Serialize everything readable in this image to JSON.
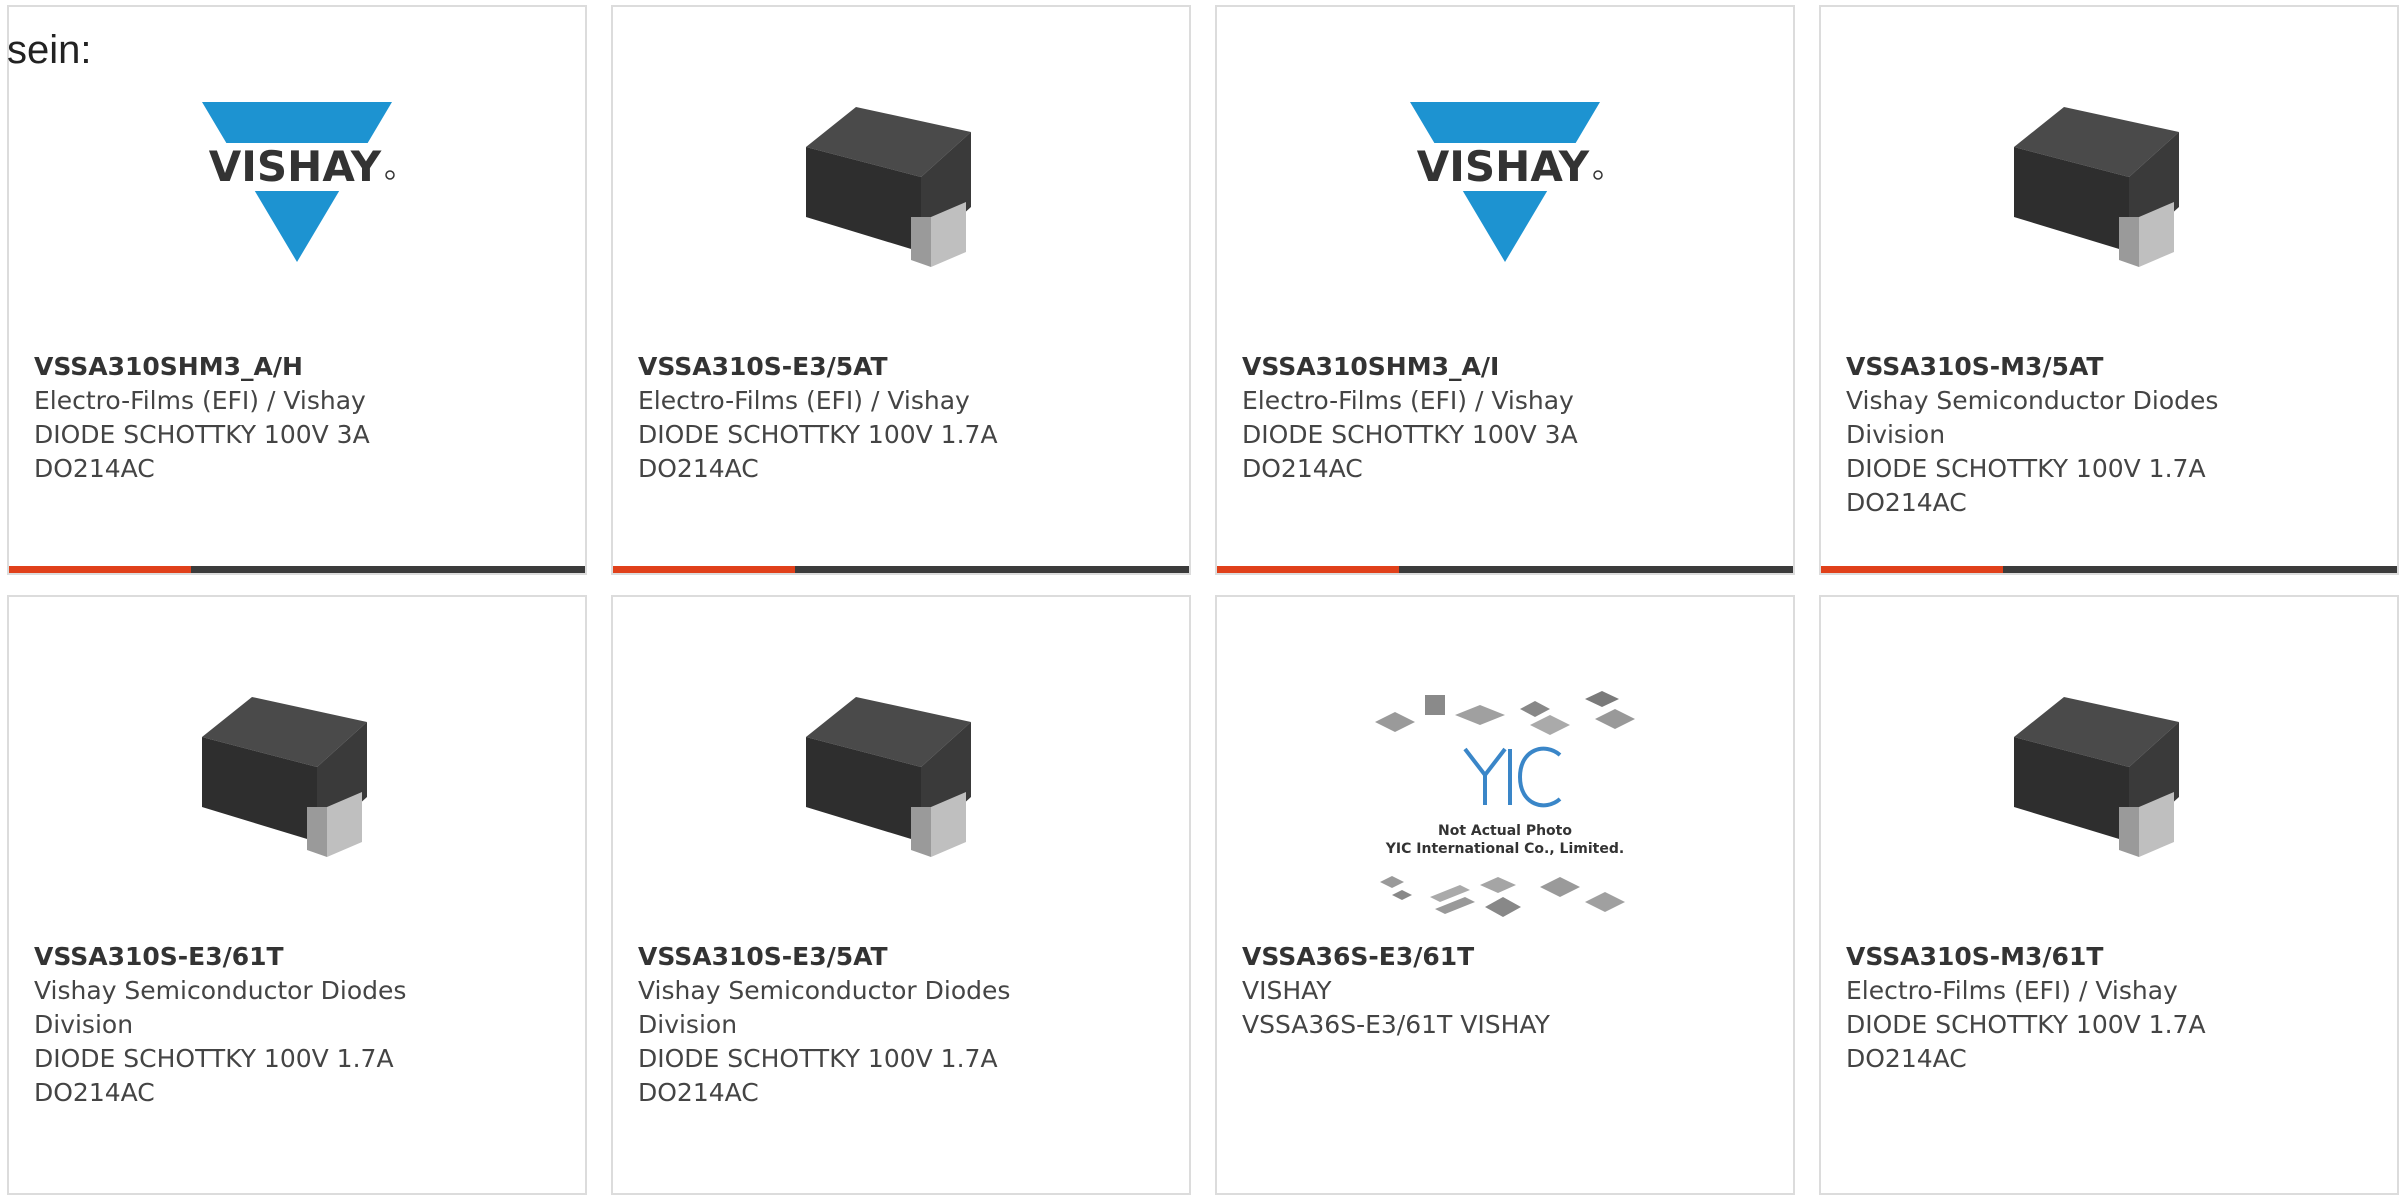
{
  "intro_text": "sein:",
  "colors": {
    "accent": "#e0401a",
    "bar": "#3b3b3b",
    "vishay_blue": "#1d93d1"
  },
  "products": [
    {
      "part_number": "VSSA310SHM3_A/H",
      "manufacturer": "Electro-Films (EFI) / Vishay",
      "desc1": "DIODE SCHOTTKY 100V 3A",
      "desc2": "DO214AC",
      "image": "vishay-logo"
    },
    {
      "part_number": "VSSA310S-E3/5AT",
      "manufacturer": "Electro-Films (EFI) / Vishay",
      "desc1": "DIODE SCHOTTKY 100V 1.7A",
      "desc2": "DO214AC",
      "image": "smd-diode-package"
    },
    {
      "part_number": "VSSA310SHM3_A/I",
      "manufacturer": "Electro-Films (EFI) / Vishay",
      "desc1": "DIODE SCHOTTKY 100V 3A",
      "desc2": "DO214AC",
      "image": "vishay-logo"
    },
    {
      "part_number": "VSSA310S-M3/5AT",
      "manufacturer": "Vishay Semiconductor Diodes Division",
      "desc1": "DIODE SCHOTTKY 100V 1.7A",
      "desc2": "DO214AC",
      "image": "smd-diode-package"
    },
    {
      "part_number": "VSSA310S-E3/61T",
      "manufacturer": "Vishay Semiconductor Diodes Division",
      "desc1": "DIODE SCHOTTKY 100V 1.7A",
      "desc2": "DO214AC",
      "image": "smd-diode-package"
    },
    {
      "part_number": "VSSA310S-E3/5AT",
      "manufacturer": "Vishay Semiconductor Diodes Division",
      "desc1": "DIODE SCHOTTKY 100V 1.7A",
      "desc2": "DO214AC",
      "image": "smd-diode-package"
    },
    {
      "part_number": "VSSA36S-E3/61T",
      "manufacturer": "VISHAY",
      "desc1": "VSSA36S-E3/61T VISHAY",
      "desc2": "",
      "image": "not-actual-photo",
      "placeholder_line1": "Not Actual Photo",
      "placeholder_line2": "YIC International Co., Limited.",
      "placeholder_logo": "YIC"
    },
    {
      "part_number": "VSSA310S-M3/61T",
      "manufacturer": "Electro-Films (EFI) / Vishay",
      "desc1": "DIODE SCHOTTKY 100V 1.7A",
      "desc2": "DO214AC",
      "image": "smd-diode-package"
    }
  ]
}
